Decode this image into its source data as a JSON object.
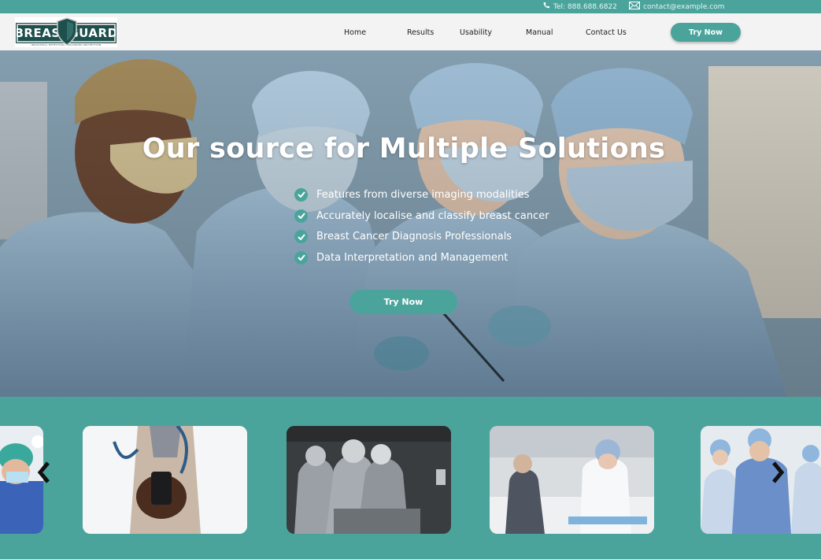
{
  "topbar": {
    "phone": "Tel: 888.688.6822",
    "email": "contact@example.com",
    "phone_icon": "phone-icon",
    "email_icon": "envelope-icon"
  },
  "brand": {
    "logo_text": "BREASTGUARD",
    "tagline": "INDUSTRIAL DETECTION · ADVANCED PROTECTION"
  },
  "nav": {
    "items": [
      {
        "label": "Home"
      },
      {
        "label": "Results"
      },
      {
        "label": "Usability"
      },
      {
        "label": "Manual"
      },
      {
        "label": "Contact Us"
      }
    ],
    "cta": "Try Now"
  },
  "hero": {
    "title": "Our source for Multiple Solutions",
    "features": [
      "Features from diverse imaging modalities",
      "Accurately localise and classify breast cancer",
      "Breast Cancer Diagnosis Professionals",
      "Data Interpretation and Management"
    ],
    "cta": "Try Now"
  },
  "carousel": {
    "prev_icon": "chevron-left-icon",
    "next_icon": "chevron-right-icon"
  },
  "colors": {
    "accent": "#4aa49b",
    "nav_bg": "#f3f3f4",
    "logo_dark": "#1d4f4c"
  }
}
